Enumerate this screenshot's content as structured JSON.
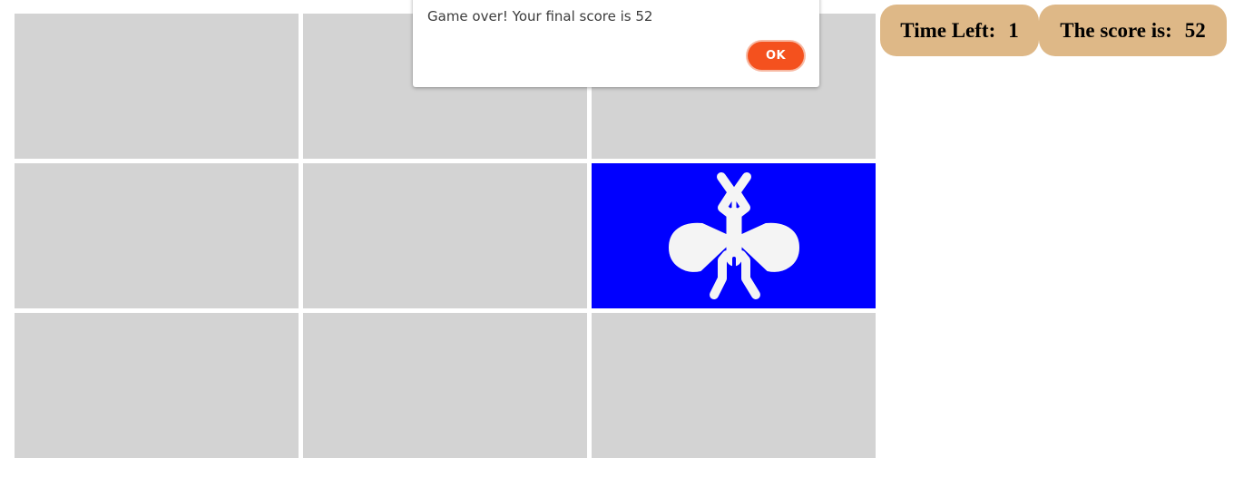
{
  "game": {
    "grid_rows": 3,
    "grid_cols": 3,
    "active_cell": 5,
    "cell_color": "#d3d3d3",
    "active_color": "#0000ff",
    "target_icon": "mosquito-icon"
  },
  "hud": {
    "time_label": "Time Left:",
    "time_value": "1",
    "score_label": "The score is:",
    "score_value": "52",
    "pill_color": "#deb887"
  },
  "dialog": {
    "message": "Game over! Your final score is 52",
    "ok_label": "OK",
    "button_color": "#f4511e"
  }
}
